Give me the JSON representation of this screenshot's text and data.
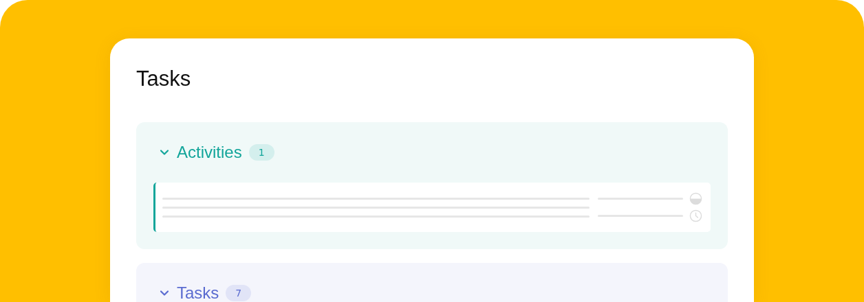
{
  "page": {
    "title": "Tasks"
  },
  "sections": [
    {
      "title": "Activities",
      "count": "1",
      "color": "#12a59a",
      "expanded": true,
      "items": [
        {
          "kind": "placeholder"
        }
      ]
    },
    {
      "title": "Tasks",
      "count": "7",
      "color": "#5a6bd0",
      "expanded": true
    }
  ]
}
